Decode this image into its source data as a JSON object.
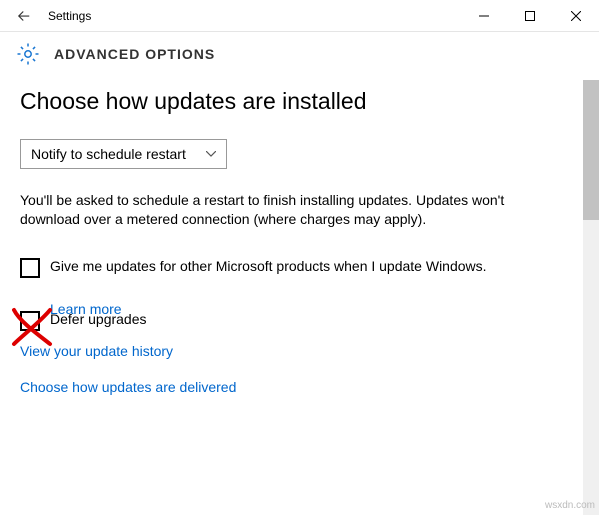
{
  "window": {
    "title": "Settings"
  },
  "header": {
    "title": "ADVANCED OPTIONS"
  },
  "main": {
    "heading": "Choose how updates are installed",
    "dropdown": {
      "selected": "Notify to schedule restart"
    },
    "description": "You'll be asked to schedule a restart to finish installing updates. Updates won't download over a metered connection (where charges may apply).",
    "checkbox1": {
      "label": "Give me updates for other Microsoft products when I update Windows.",
      "checked": false
    },
    "checkbox2": {
      "label": "Defer upgrades",
      "learn_more": "Learn more",
      "checked": false,
      "annotation": "red-x-mark"
    },
    "links": {
      "history": "View your update history",
      "delivery": "Choose how updates are delivered"
    }
  },
  "watermark": "wsxdn.com"
}
